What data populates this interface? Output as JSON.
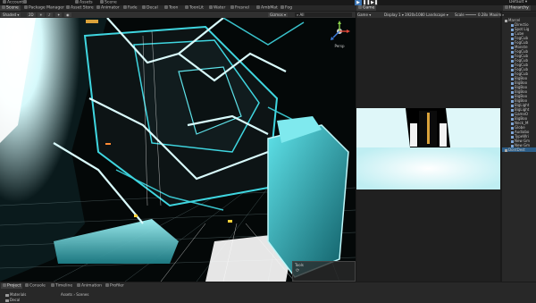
{
  "toolbar": {
    "account_label": "Account",
    "assets_label": "Assets",
    "play_icon": "play-icon",
    "pause_icon": "pause-icon",
    "step_icon": "step-icon",
    "layout_label": "Default"
  },
  "tabs": {
    "scene": "Scene",
    "package_manager": "Package Manager",
    "asset_store": "Asset Store",
    "animator": "Animator",
    "fade": "Fade",
    "decal": "Decal",
    "toon": "Toon",
    "toonlit": "ToonLit",
    "water": "Water",
    "fresnel": "Fresnel",
    "ambient": "AmbMat",
    "fog": "Fog",
    "game": "Game",
    "hierarchy": "Hierarchy"
  },
  "scene_toolbar": {
    "shading": "Shaded",
    "mode_2d": "2D",
    "gizmos": "Gizmos",
    "search": "All"
  },
  "gizmo": {
    "label": "Persp",
    "axis_y": "y",
    "axis_x": "x",
    "axis_z": "z"
  },
  "game_toolbar": {
    "display_mode": "Game",
    "display": "Display 1",
    "resolution": "1920x1080 Landscape",
    "scale_label": "Scale",
    "scale_value": "0.28x",
    "maximize": "Maxim"
  },
  "hierarchy": {
    "root": "Marcel",
    "items": [
      "Directio",
      "Spot Lig",
      "Cube",
      "FogCub",
      "FogCub",
      "Monste",
      "FogCub",
      "FogCub",
      "FogCub",
      "FogCub",
      "FogCub",
      "FogCub",
      "BigBoo",
      "BigBoo",
      "BigBoo",
      "BigBoo",
      "BigBoo",
      "BigBoo",
      "BigLight",
      "BigLight",
      "GameO",
      "BigBoo",
      "Neck_M",
      "Globe",
      "Audiobo",
      "TypeWri",
      "New Gm",
      "New Gm"
    ],
    "bottom_root": "DontDest"
  },
  "bottom": {
    "project": "Project",
    "console": "Console",
    "timeline": "Timeline",
    "animation": "Animation",
    "profiler": "Profiler",
    "folders": [
      "Materials",
      "Decal"
    ],
    "breadcrumb_assets": "Assets",
    "breadcrumb_scenes": "Scenes"
  },
  "overlay": {
    "title": "Tools"
  },
  "colors": {
    "accent_blue": "#3a72b0",
    "selection": "#2c5d87",
    "neon_cyan": "#3fd6e0",
    "panel": "#282828"
  }
}
